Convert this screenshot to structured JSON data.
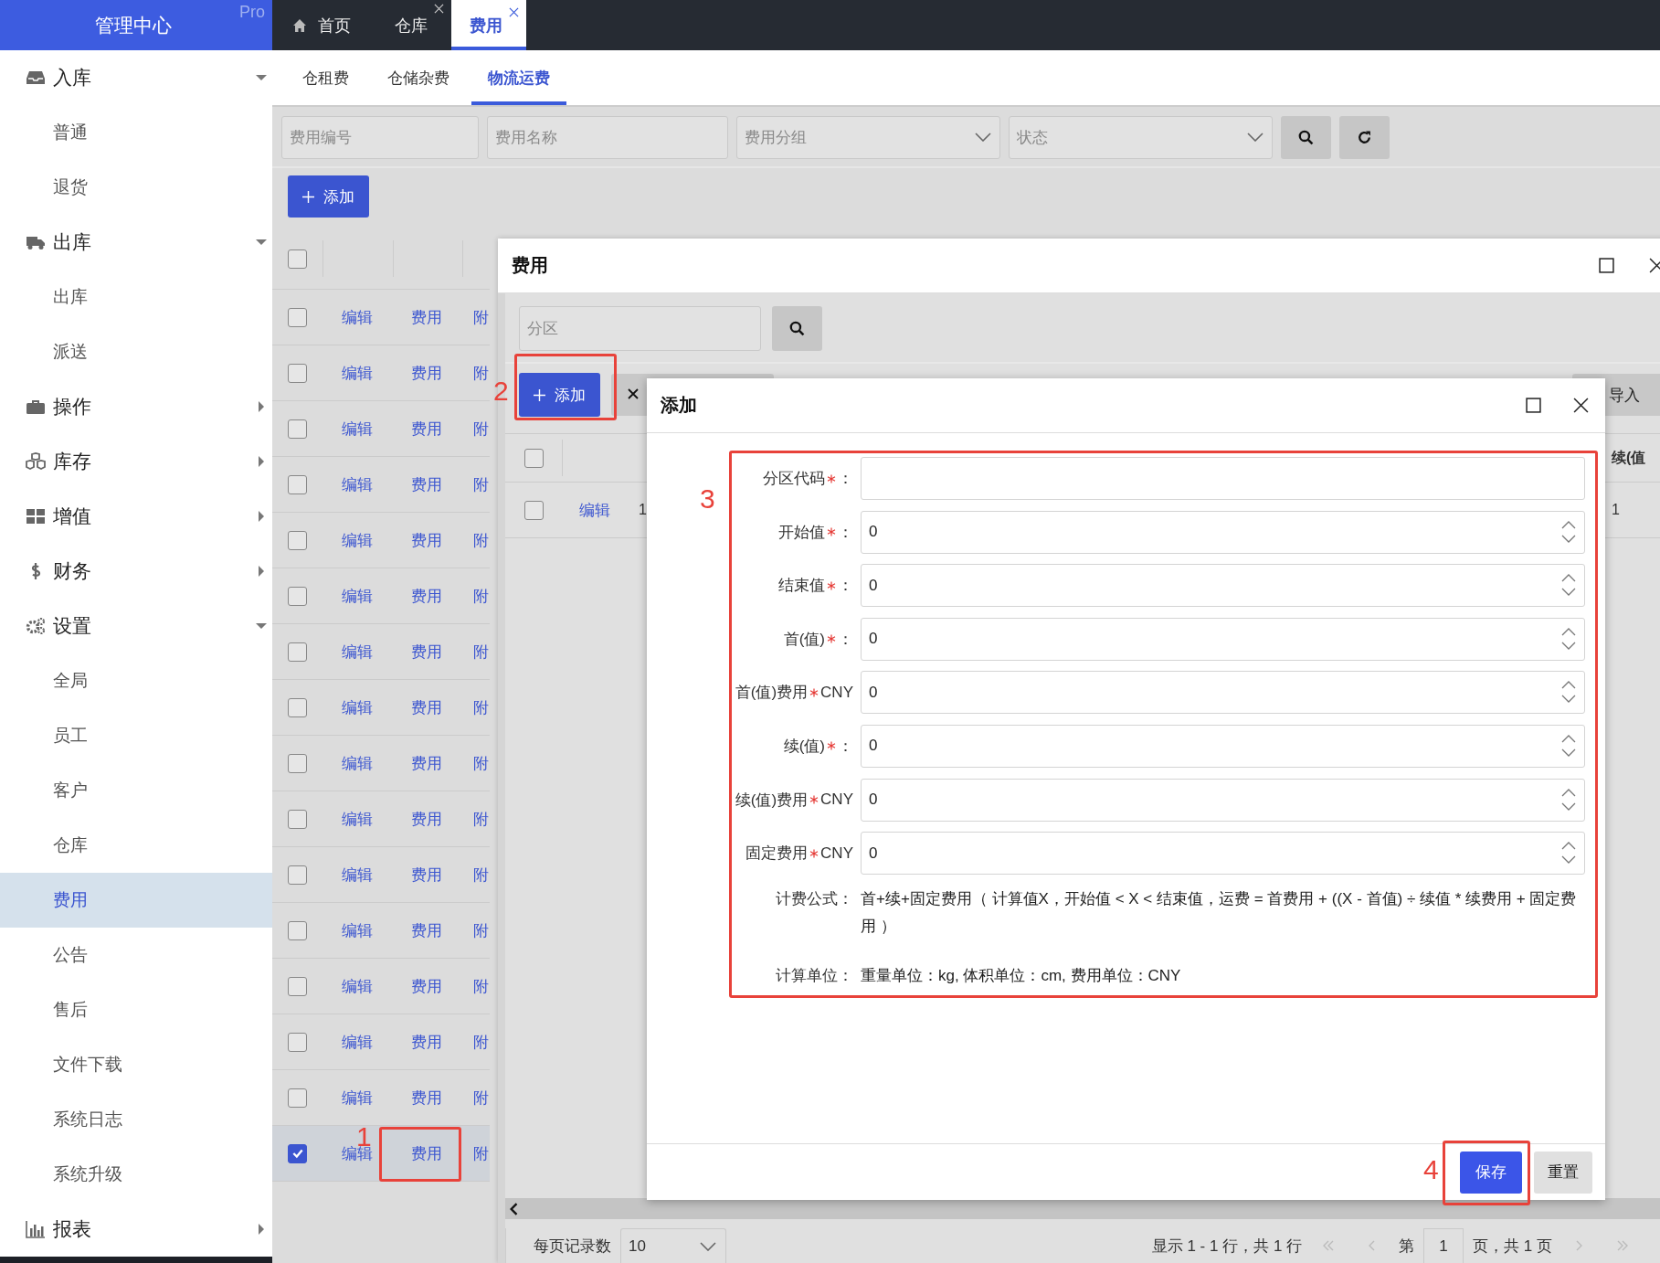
{
  "sidebar": {
    "title": "管理中心",
    "badge": "Pro",
    "items": [
      {
        "label": "入库",
        "expanded": true,
        "children": [
          {
            "label": "普通",
            "selected": false
          },
          {
            "label": "退货",
            "selected": false
          }
        ]
      },
      {
        "label": "出库",
        "expanded": true,
        "children": [
          {
            "label": "出库",
            "selected": false
          },
          {
            "label": "派送",
            "selected": false
          }
        ]
      },
      {
        "label": "操作",
        "expanded": false
      },
      {
        "label": "库存",
        "expanded": false
      },
      {
        "label": "增值",
        "expanded": false
      },
      {
        "label": "财务",
        "expanded": false
      },
      {
        "label": "设置",
        "expanded": true,
        "children": [
          {
            "label": "全局",
            "selected": false
          },
          {
            "label": "员工",
            "selected": false
          },
          {
            "label": "客户",
            "selected": false
          },
          {
            "label": "仓库",
            "selected": false
          },
          {
            "label": "费用",
            "selected": true
          },
          {
            "label": "公告",
            "selected": false
          },
          {
            "label": "售后",
            "selected": false
          },
          {
            "label": "文件下载",
            "selected": false
          },
          {
            "label": "系统日志",
            "selected": false
          },
          {
            "label": "系统升级",
            "selected": false
          }
        ]
      },
      {
        "label": "报表",
        "expanded": false
      }
    ]
  },
  "top_tabs": [
    {
      "label": "首页",
      "selected": false,
      "closable": false
    },
    {
      "label": "仓库",
      "selected": false,
      "closable": true
    },
    {
      "label": "费用",
      "selected": true,
      "closable": true
    }
  ],
  "sub_tabs": [
    {
      "label": "仓租费",
      "selected": false
    },
    {
      "label": "仓储杂费",
      "selected": false
    },
    {
      "label": "物流运费",
      "selected": true
    }
  ],
  "filters": [
    {
      "placeholder": "费用编号",
      "kind": "text"
    },
    {
      "placeholder": "费用名称",
      "kind": "text"
    },
    {
      "placeholder": "费用分组",
      "kind": "select"
    },
    {
      "placeholder": "状态",
      "kind": "select"
    }
  ],
  "add_button": "添加",
  "table": {
    "header_checked": false,
    "rows": [
      {
        "checked": false,
        "actions": [
          "编辑",
          "费用",
          "附"
        ]
      },
      {
        "checked": false,
        "actions": [
          "编辑",
          "费用",
          "附"
        ]
      },
      {
        "checked": false,
        "actions": [
          "编辑",
          "费用",
          "附"
        ]
      },
      {
        "checked": false,
        "actions": [
          "编辑",
          "费用",
          "附"
        ]
      },
      {
        "checked": false,
        "actions": [
          "编辑",
          "费用",
          "附"
        ]
      },
      {
        "checked": false,
        "actions": [
          "编辑",
          "费用",
          "附"
        ]
      },
      {
        "checked": false,
        "actions": [
          "编辑",
          "费用",
          "附"
        ]
      },
      {
        "checked": false,
        "actions": [
          "编辑",
          "费用",
          "附"
        ]
      },
      {
        "checked": false,
        "actions": [
          "编辑",
          "费用",
          "附"
        ]
      },
      {
        "checked": false,
        "actions": [
          "编辑",
          "费用",
          "附"
        ]
      },
      {
        "checked": false,
        "actions": [
          "编辑",
          "费用",
          "附"
        ]
      },
      {
        "checked": false,
        "actions": [
          "编辑",
          "费用",
          "附"
        ]
      },
      {
        "checked": false,
        "actions": [
          "编辑",
          "费用",
          "附"
        ]
      },
      {
        "checked": false,
        "actions": [
          "编辑",
          "费用",
          "附"
        ]
      },
      {
        "checked": false,
        "actions": [
          "编辑",
          "费用",
          "附"
        ]
      },
      {
        "checked": true,
        "actions": [
          "编辑",
          "费用",
          "附"
        ]
      }
    ]
  },
  "fee_dialog": {
    "title": "费用",
    "search": {
      "placeholder": "分区"
    },
    "add_button": "添加",
    "import_button": "导入",
    "table": {
      "header_checked": false,
      "last_column": "续(值",
      "rows": [
        {
          "checked": false,
          "action": "编辑",
          "column_3": "1",
          "last_cell": "1"
        }
      ]
    },
    "pagination": {
      "page_size_label": "每页记录数",
      "page_size": "10",
      "summary": "显示 1 - 1 行，共 1 行",
      "page_prefix": "第",
      "page": "1",
      "page_suffix": "页，共 1 页"
    }
  },
  "add_dialog": {
    "title": "添加",
    "fields": [
      {
        "label": "分区代码",
        "required": true,
        "suffix": "：",
        "kind": "text"
      },
      {
        "label": "开始值",
        "required": true,
        "suffix": "：",
        "kind": "number",
        "value": "0"
      },
      {
        "label": "结束值",
        "required": true,
        "suffix": "：",
        "kind": "number",
        "value": "0"
      },
      {
        "label": "首(值)",
        "required": true,
        "suffix": "：",
        "kind": "number",
        "value": "0"
      },
      {
        "label": "首(值)费用",
        "required": true,
        "suffix": "CNY",
        "kind": "number",
        "value": "0"
      },
      {
        "label": "续(值)",
        "required": true,
        "suffix": "：",
        "kind": "number",
        "value": "0"
      },
      {
        "label": "续(值)费用",
        "required": true,
        "suffix": "CNY",
        "kind": "number",
        "value": "0"
      },
      {
        "label": "固定费用",
        "required": true,
        "suffix": "CNY",
        "kind": "number",
        "value": "0"
      }
    ],
    "info": [
      {
        "label": "计费公式：",
        "text": "首+续+固定费用（ 计算值X，开始值 < X < 结束值，运费 = 首费用 + ((X - 首值) ÷ 续值 * 续费用 + 固定费用 ）"
      },
      {
        "label": "计算单位：",
        "text": "重量单位：kg, 体积单位：cm, 费用单位：CNY"
      }
    ],
    "buttons": [
      {
        "label": "保存",
        "kind": "primary"
      },
      {
        "label": "重置",
        "kind": "default"
      }
    ]
  },
  "annotations": [
    {
      "label": "1"
    },
    {
      "label": "2"
    },
    {
      "label": "3"
    },
    {
      "label": "4"
    }
  ]
}
